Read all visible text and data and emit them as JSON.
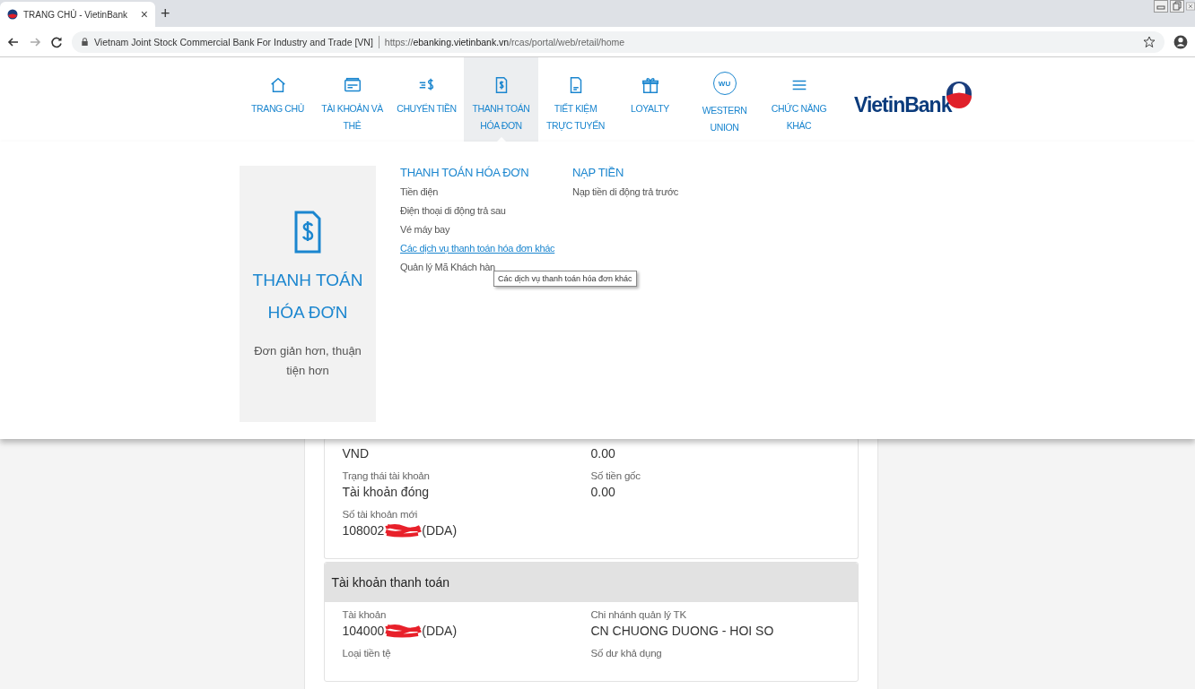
{
  "browser": {
    "tab_title": "TRANG CHỦ - VietinBank",
    "tab_close": "×",
    "new_tab": "+",
    "site_name": "Vietnam Joint Stock Commercial Bank For Industry and Trade [VN]",
    "url": "https://**ebanking.vietinbank.vn**/rcas/portal/web/retail/home"
  },
  "nav": {
    "items": [
      {
        "label": "TRANG CHỦ",
        "kind": "home",
        "selected": false
      },
      {
        "label": "TÀI KHOẢN VÀ THẺ",
        "kind": "card",
        "selected": false
      },
      {
        "label": "CHUYỂN TIỀN",
        "kind": "transfer",
        "selected": false
      },
      {
        "label": "THANH TOÁN HÓA ĐƠN",
        "kind": "bill",
        "selected": true
      },
      {
        "label": "TIẾT KIỆM TRỰC TUYẾN",
        "kind": "doc",
        "selected": false
      },
      {
        "label": "LOYALTY",
        "kind": "gift",
        "selected": false
      },
      {
        "label": "WESTERN UNION",
        "kind": "badge",
        "badge": "WU",
        "selected": false
      },
      {
        "label": "CHỨC NĂNG KHÁC",
        "kind": "menu",
        "selected": false
      }
    ],
    "logo": "VietinBank"
  },
  "dropdown": {
    "feature": {
      "title": "THANH TOÁN HÓA ĐƠN",
      "subtitle": "Đơn giản hơn, thuận tiện hơn"
    },
    "columns": [
      {
        "heading": "THANH TOÁN HÓA ĐƠN",
        "links": [
          {
            "label": "Tiền điện",
            "hovered": false
          },
          {
            "label": "Điện thoại di động trả sau",
            "hovered": false
          },
          {
            "label": "Vé máy bay",
            "hovered": false
          },
          {
            "label": "Các dịch vụ thanh toán hóa đơn khác",
            "hovered": true
          },
          {
            "label": "Quản lý Mã Khách hàn",
            "hovered": false
          }
        ]
      },
      {
        "heading": "NẠP TIỀN",
        "links": [
          {
            "label": "Nạp tiền di động trả trước",
            "hovered": false
          }
        ]
      }
    ],
    "tooltip": "Các dịch vụ thanh toán hóa đơn khác"
  },
  "cards": [
    {
      "rows": [
        [
          {
            "value": "VND"
          },
          {
            "value": "0.00"
          }
        ],
        [
          {
            "label": "Trạng thái tài khoản",
            "value": "Tài khoản đóng"
          },
          {
            "label": "Số tiền gốc",
            "value": "0.00"
          }
        ],
        [
          {
            "label": "Số tài khoản mới",
            "value": "108002",
            "redacted": true,
            "suffix": "(DDA)"
          }
        ]
      ]
    },
    {
      "header": "Tài khoản thanh toán",
      "rows": [
        [
          {
            "label": "Tài khoản",
            "value": "104000",
            "redacted": true,
            "suffix": "(DDA)"
          },
          {
            "label": "Chi nhánh quản lý TK",
            "value": "CN CHUONG DUONG - HOI SO"
          }
        ],
        [
          {
            "label": "Loại tiền tệ"
          },
          {
            "label": "Số dư khả dụng"
          }
        ]
      ]
    }
  ]
}
